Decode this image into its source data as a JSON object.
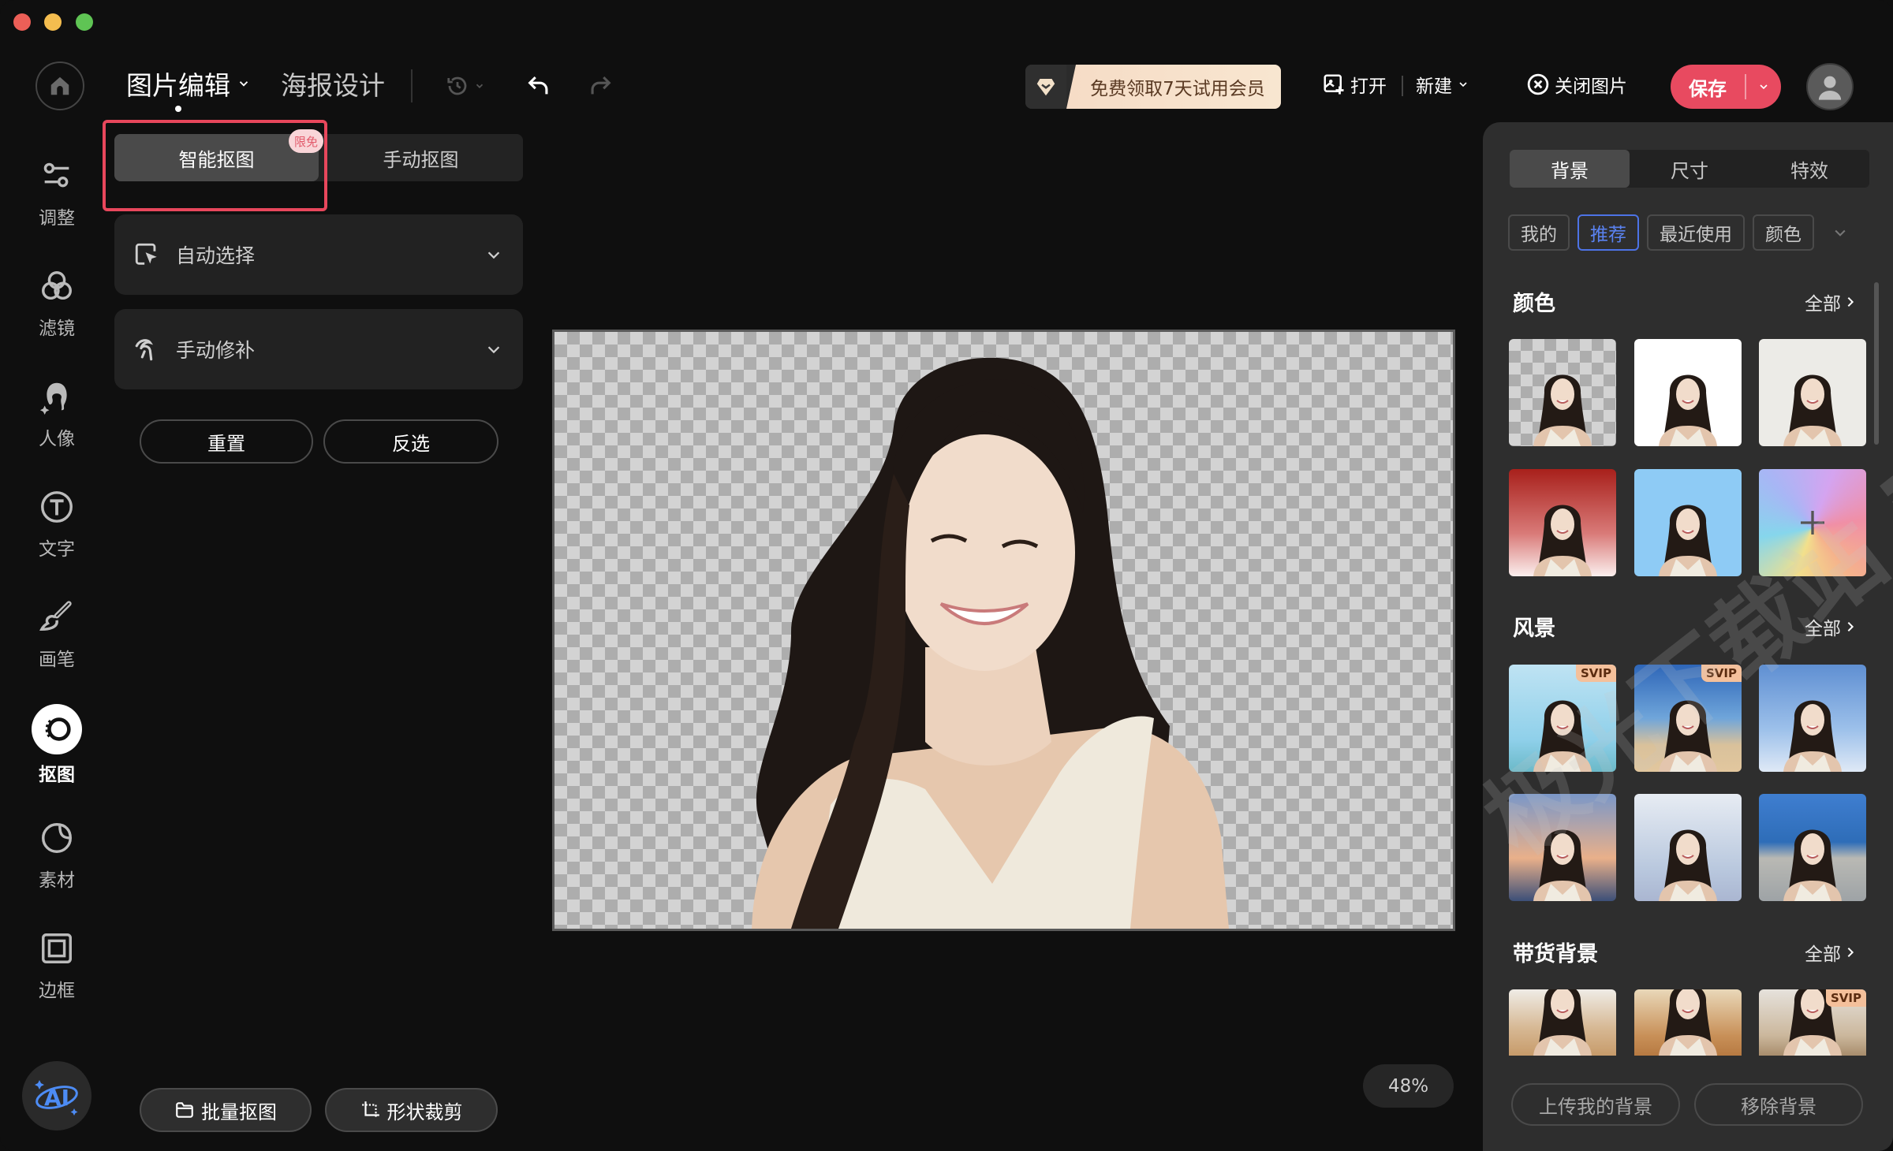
{
  "window": {
    "traffic_lights": [
      "close",
      "minimize",
      "zoom"
    ]
  },
  "header": {
    "home_icon": "home-icon",
    "main_tab": "图片编辑",
    "secondary_tab": "海报设计",
    "history_icon": "history-icon",
    "undo_icon": "undo-icon",
    "redo_icon": "redo-icon",
    "promo_text": "免费领取7天试用会员",
    "open_label": "打开",
    "new_label": "新建",
    "close_image_label": "关闭图片",
    "save_label": "保存"
  },
  "rail": {
    "items": [
      {
        "label": "调整",
        "icon": "sliders-icon",
        "active": false
      },
      {
        "label": "滤镜",
        "icon": "filter-icon",
        "active": false
      },
      {
        "label": "人像",
        "icon": "portrait-icon",
        "active": false
      },
      {
        "label": "文字",
        "icon": "text-icon",
        "active": false
      },
      {
        "label": "画笔",
        "icon": "brush-icon",
        "active": false
      },
      {
        "label": "抠图",
        "icon": "cutout-icon",
        "active": true
      },
      {
        "label": "素材",
        "icon": "sticker-icon",
        "active": false
      },
      {
        "label": "边框",
        "icon": "frame-icon",
        "active": false
      }
    ],
    "ai_label": "AI"
  },
  "left_panel": {
    "tabs": [
      {
        "label": "智能抠图",
        "active": true,
        "badge": "限免"
      },
      {
        "label": "手动抠图",
        "active": false
      }
    ],
    "sections": [
      {
        "label": "自动选择",
        "icon": "auto-select-icon"
      },
      {
        "label": "手动修补",
        "icon": "manual-brush-icon"
      }
    ],
    "reset_label": "重置",
    "invert_label": "反选",
    "batch_label": "批量抠图",
    "shape_crop_label": "形状裁剪"
  },
  "canvas": {
    "zoom_level": "48%"
  },
  "right_panel": {
    "tabs": [
      {
        "label": "背景",
        "active": true
      },
      {
        "label": "尺寸",
        "active": false
      },
      {
        "label": "特效",
        "active": false
      }
    ],
    "chips": [
      {
        "label": "我的",
        "active": false
      },
      {
        "label": "推荐",
        "active": true
      },
      {
        "label": "最近使用",
        "active": false
      },
      {
        "label": "颜色",
        "active": false
      }
    ],
    "sections": [
      {
        "title": "颜色",
        "all_label": "全部"
      },
      {
        "title": "风景",
        "all_label": "全部"
      },
      {
        "title": "带货背景",
        "all_label": "全部"
      }
    ],
    "svip_label": "SVIP",
    "upload_label": "上传我的背景",
    "remove_label": "移除背景"
  },
  "watermark": "极光下载站 jgappcom",
  "colors": {
    "accent_red": "#e84a60",
    "accent_blue": "#4d73e6",
    "panel_bg": "#2e2e2e",
    "app_bg": "#0f0f0f"
  }
}
